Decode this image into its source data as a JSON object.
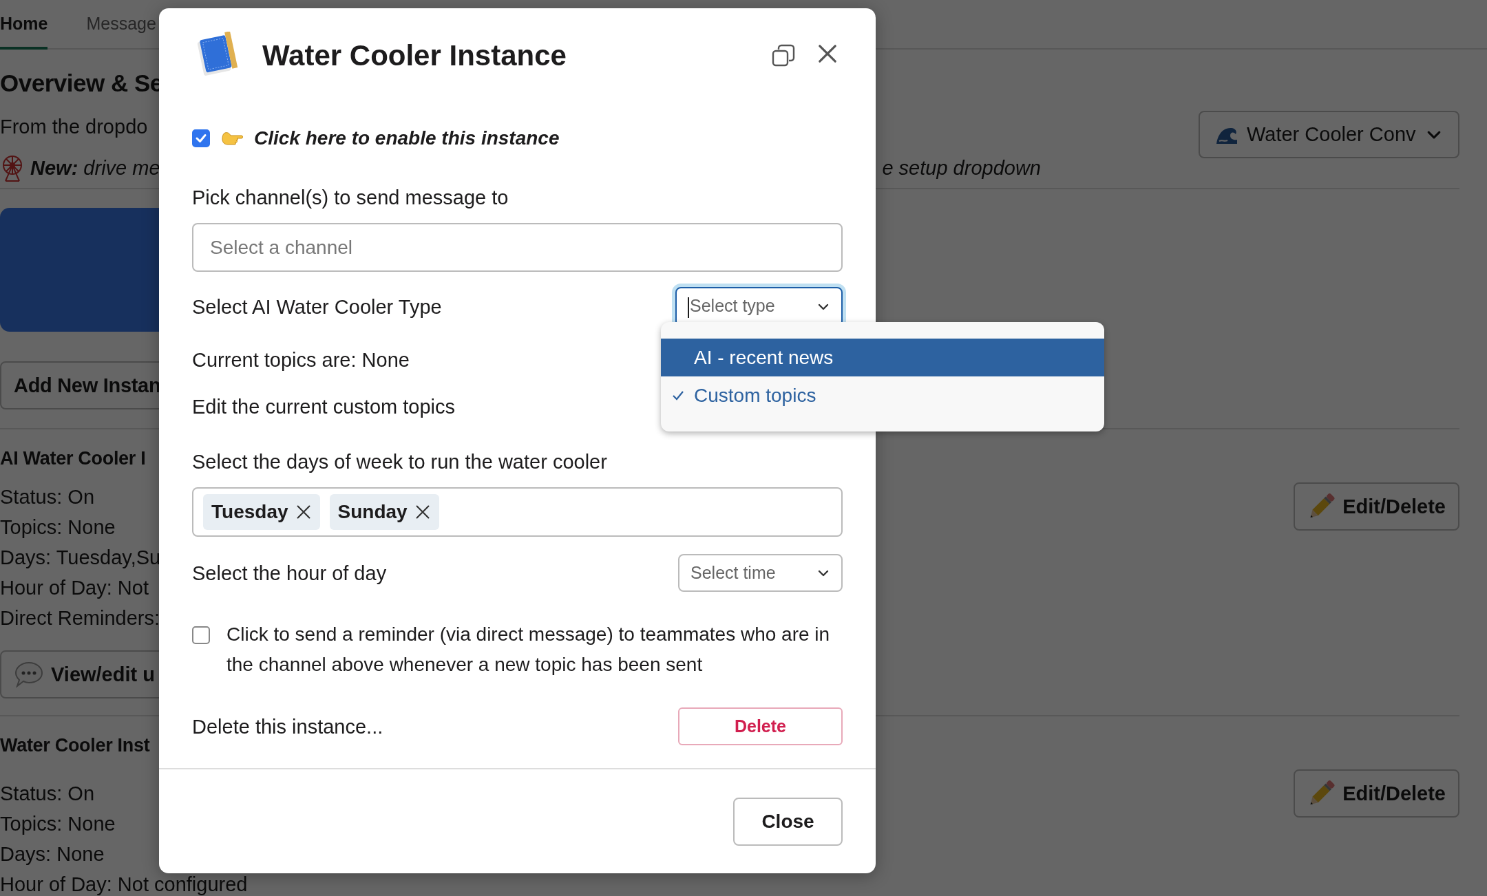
{
  "background_page": {
    "tabs": [
      {
        "label": "Home",
        "selected": true
      },
      {
        "label": "Message",
        "selected": false
      }
    ],
    "heading": "Overview & Se",
    "intro": "From the dropdo",
    "notice": "**New:** drive me",
    "notice_tail": "e setup dropdown",
    "conversation_select": {
      "value": "Water Cooler Conv"
    },
    "add_button": "Add New Instan",
    "instances": [
      {
        "title": "AI Water Cooler I",
        "details": [
          "Status: On",
          "Topics: None",
          "Days: Tuesday,Su",
          "Hour of Day: Not",
          "Direct Reminders:"
        ],
        "view_button": "View/edit u",
        "edit_button": "Edit/Delete"
      },
      {
        "title": "Water Cooler Inst",
        "details": [
          "Status: On",
          "Topics: None",
          "Days: None",
          "Hour of Day: Not configured"
        ],
        "edit_button": "Edit/Delete"
      }
    ]
  },
  "modal": {
    "title": "Water Cooler Instance",
    "enable": {
      "label": "Click here to enable this instance",
      "checked": true
    },
    "channel": {
      "label": "Pick channel(s) to send message to",
      "placeholder": "Select a channel"
    },
    "type": {
      "label": "Select AI Water Cooler Type",
      "placeholder": "Select type",
      "focused": true,
      "expanded": true,
      "options": [
        {
          "label": "AI - recent news",
          "highlighted": true,
          "selected": false
        },
        {
          "label": "Custom topics",
          "highlighted": false,
          "selected": true
        }
      ]
    },
    "current_topics": "Current topics are: None",
    "edit_topics": "Edit the current custom topics",
    "days": {
      "label": "Select the days of week to run the water cooler",
      "chips": [
        "Tuesday",
        "Sunday"
      ]
    },
    "hour": {
      "label": "Select the hour of day",
      "placeholder": "Select time"
    },
    "reminder": {
      "label": "Click to send a reminder (via direct message) to teammates who are in the channel above whenever a new topic has been sent",
      "checked": false
    },
    "delete": {
      "label": "Delete this instance...",
      "button": "Delete"
    },
    "close_button": "Close"
  }
}
